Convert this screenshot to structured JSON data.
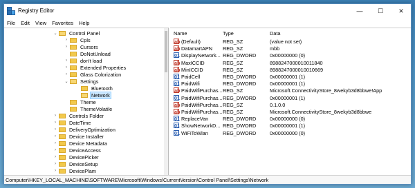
{
  "window": {
    "title": "Registry Editor",
    "minimize_glyph": "—",
    "maximize_glyph": "☐",
    "close_glyph": "✕"
  },
  "menu": [
    "File",
    "Edit",
    "View",
    "Favorites",
    "Help"
  ],
  "tree": {
    "items": [
      {
        "label": "Control Panel",
        "expander": "⌄",
        "folder": "open"
      },
      {
        "label": "Cpls",
        "expander": "›",
        "folder": "closed"
      },
      {
        "label": "Cursors",
        "expander": "›",
        "folder": "closed"
      },
      {
        "label": "DoNotUnload",
        "expander": "",
        "folder": "closed"
      },
      {
        "label": "don't load",
        "expander": "›",
        "folder": "closed"
      },
      {
        "label": "Extended Properties",
        "expander": "›",
        "folder": "closed"
      },
      {
        "label": "Glass Colorization",
        "expander": "›",
        "folder": "closed"
      },
      {
        "label": "Settings",
        "expander": "⌄",
        "folder": "open"
      },
      {
        "label": "Bluetooth",
        "expander": "",
        "folder": "closed"
      },
      {
        "label": "Network",
        "expander": "",
        "folder": "open",
        "selected": true
      },
      {
        "label": "Theme",
        "expander": "",
        "folder": "closed"
      },
      {
        "label": "ThemeVolatile",
        "expander": "",
        "folder": "closed"
      },
      {
        "label": "Controls Folder",
        "expander": "›",
        "folder": "closed"
      },
      {
        "label": "DateTime",
        "expander": "›",
        "folder": "closed"
      },
      {
        "label": "DeliveryOptimization",
        "expander": "›",
        "folder": "closed"
      },
      {
        "label": "Device Installer",
        "expander": "›",
        "folder": "closed"
      },
      {
        "label": "Device Metadata",
        "expander": "›",
        "folder": "closed"
      },
      {
        "label": "DeviceAccess",
        "expander": "›",
        "folder": "closed"
      },
      {
        "label": "DevicePicker",
        "expander": "›",
        "folder": "closed"
      },
      {
        "label": "DeviceSetup",
        "expander": "›",
        "folder": "closed"
      },
      {
        "label": "DevicePlam",
        "expander": "›",
        "folder": "closed"
      }
    ]
  },
  "values": {
    "headers": {
      "name": "Name",
      "type": "Type",
      "data": "Data"
    },
    "rows": [
      {
        "icon": "ab",
        "name": "(Default)",
        "type": "REG_SZ",
        "data": "(value not set)"
      },
      {
        "icon": "ab",
        "name": "DatamartAPN",
        "type": "REG_SZ",
        "data": "mbb"
      },
      {
        "icon": "dword",
        "name": "DisplayNetwork...",
        "type": "REG_DWORD",
        "data": "0x00000000 (0)"
      },
      {
        "icon": "ab",
        "name": "MaxICCID",
        "type": "REG_SZ",
        "data": "8988247000010011840"
      },
      {
        "icon": "ab",
        "name": "MinICCID",
        "type": "REG_SZ",
        "data": "8988247000010010669"
      },
      {
        "icon": "dword",
        "name": "PaidCell",
        "type": "REG_DWORD",
        "data": "0x00000001 (1)"
      },
      {
        "icon": "dword",
        "name": "PaidWifi",
        "type": "REG_DWORD",
        "data": "0x00000001 (1)"
      },
      {
        "icon": "ab",
        "name": "PaidWifiPurchas...",
        "type": "REG_SZ",
        "data": "Microsoft.ConnectivityStore_8wekyb3d8bbwe!App"
      },
      {
        "icon": "dword",
        "name": "PaidWifiPurchas...",
        "type": "REG_DWORD",
        "data": "0x00000001 (1)"
      },
      {
        "icon": "ab",
        "name": "PaidWifiPurchas...",
        "type": "REG_SZ",
        "data": "0.1.0.0"
      },
      {
        "icon": "ab",
        "name": "PaidWifiPurchas...",
        "type": "REG_SZ",
        "data": "Microsoft.ConnectivityStore_8wekyb3d8bbwe"
      },
      {
        "icon": "dword",
        "name": "ReplaceVan",
        "type": "REG_DWORD",
        "data": "0x00000000 (0)"
      },
      {
        "icon": "dword",
        "name": "ShowNetworkD...",
        "type": "REG_DWORD",
        "data": "0x00000001 (1)"
      },
      {
        "icon": "dword",
        "name": "WiFiToWlan",
        "type": "REG_DWORD",
        "data": "0x00000000 (0)"
      }
    ]
  },
  "status": {
    "path": "Computer\\HKEY_LOCAL_MACHINE\\SOFTWARE\\Microsoft\\Windows\\CurrentVersion\\Control Panel\\Settings\\Network"
  }
}
